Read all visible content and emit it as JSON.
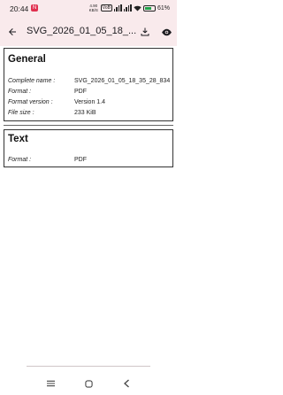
{
  "status_bar": {
    "time": "20:44",
    "notification_badge": "N",
    "network_speed": "4.90 KB/S",
    "volte": "VoB",
    "battery_percent": "61%"
  },
  "app_bar": {
    "title": "SVG_2026_01_05_18_..."
  },
  "sections": {
    "general": {
      "title": "General",
      "rows": [
        {
          "label": "Complete name :",
          "value": "SVG_2026_01_05_18_35_28_834"
        },
        {
          "label": "Format :",
          "value": "PDF"
        },
        {
          "label": "Format version :",
          "value": "Version 1.4"
        },
        {
          "label": "File size :",
          "value": "233 KiB"
        }
      ]
    },
    "text": {
      "title": "Text",
      "rows": [
        {
          "label": "Format :",
          "value": "PDF"
        }
      ]
    }
  },
  "icons": {
    "back": "arrow-left-icon",
    "download": "download-icon",
    "view": "eye-icon",
    "nav_menu": "menu-icon",
    "nav_home": "home-icon",
    "nav_back": "chevron-left-icon"
  }
}
